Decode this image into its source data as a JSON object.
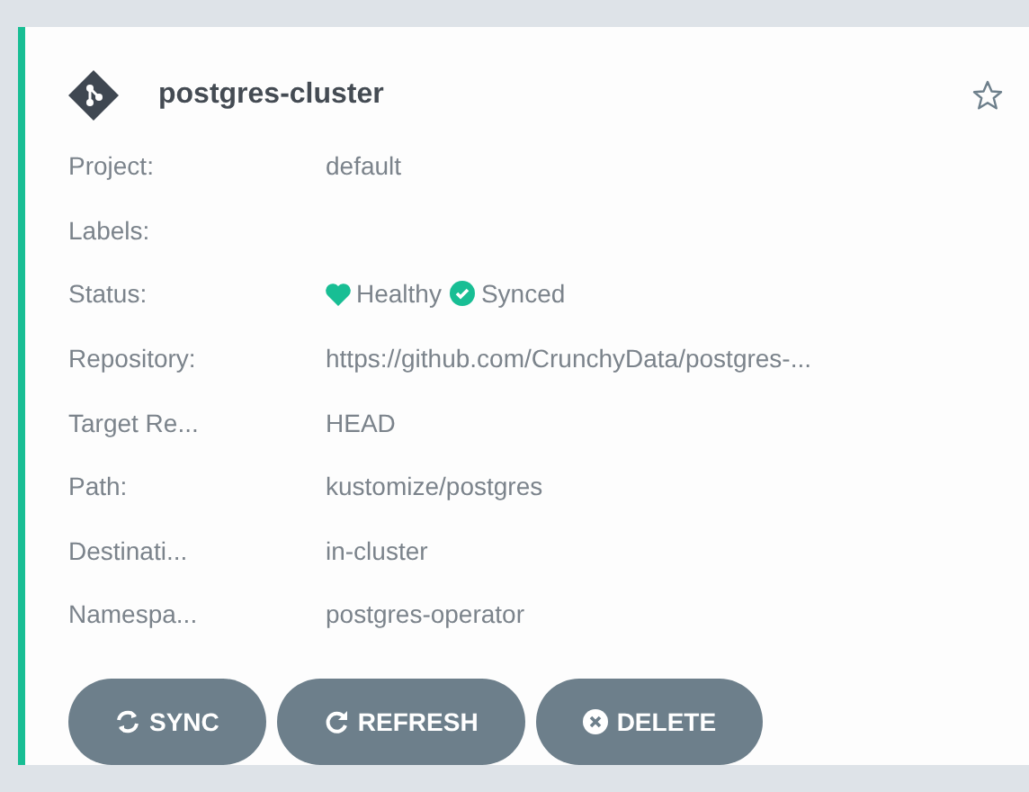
{
  "app": {
    "name": "postgres-cluster",
    "favorite": false
  },
  "fields": [
    {
      "kind": "text",
      "label": "Project:",
      "value": "default"
    },
    {
      "kind": "text",
      "label": "Labels:"
    },
    {
      "kind": "status",
      "label": "Status:",
      "items": [
        {
          "kind": "health",
          "text": "Healthy"
        },
        {
          "kind": "sync",
          "text": "Synced"
        }
      ]
    },
    {
      "kind": "text",
      "label": "Repository:",
      "value": "https://github.com/CrunchyData/postgres-..."
    },
    {
      "kind": "text",
      "label": "Target Re...",
      "value": "HEAD"
    },
    {
      "kind": "text",
      "label": "Path:",
      "value": "kustomize/postgres"
    },
    {
      "kind": "text",
      "label": "Destinati...",
      "value": "in-cluster"
    },
    {
      "kind": "text",
      "label": "Namespa...",
      "value": "postgres-operator"
    }
  ],
  "buttons": [
    {
      "kind": "sync",
      "label": "SYNC"
    },
    {
      "kind": "refresh",
      "label": "REFRESH"
    },
    {
      "kind": "delete",
      "label": "DELETE"
    }
  ]
}
